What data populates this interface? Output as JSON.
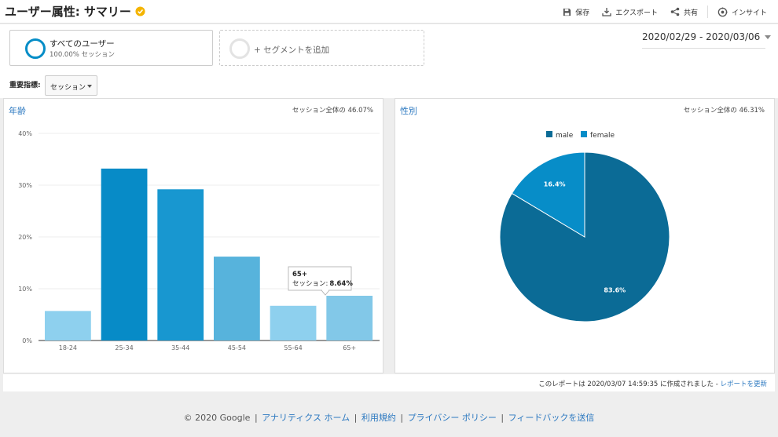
{
  "header": {
    "title": "ユーザー属性: サマリー",
    "toolbar": [
      {
        "icon": "save-icon",
        "label": "保存"
      },
      {
        "icon": "export-icon",
        "label": "エクスポート"
      },
      {
        "icon": "share-icon",
        "label": "共有"
      },
      {
        "icon": "insights-icon",
        "label": "インサイト"
      }
    ]
  },
  "segments": {
    "active": {
      "name": "すべてのユーザー",
      "sub": "100.00% セッション"
    },
    "add_label": "+ セグメントを追加"
  },
  "date_range": "2020/02/29 - 2020/03/06",
  "kpi": {
    "label": "重要指標:",
    "value": "セッション"
  },
  "age_panel": {
    "title": "年齢",
    "meta": "セッション全体の 46.07%"
  },
  "gender_panel": {
    "title": "性別",
    "meta": "セッション全体の 46.31%"
  },
  "tooltip": {
    "category": "65+",
    "label": "セッション:",
    "value": "8.64%"
  },
  "report": {
    "text": "このレポートは 2020/03/07 14:59:35 に作成されました - ",
    "link": "レポートを更新"
  },
  "footer": {
    "copyright": "© 2020 Google",
    "links": [
      "アナリティクス ホーム",
      "利用規約",
      "プライバシー ポリシー",
      "フィードバックを送信"
    ]
  },
  "colors": {
    "accent": "#058dc7",
    "male": "#0b6b96",
    "female": "#078dc8"
  },
  "chart_data": [
    {
      "type": "bar",
      "title": "年齢",
      "categories": [
        "18-24",
        "25-34",
        "35-44",
        "45-54",
        "55-64",
        "65+"
      ],
      "values": [
        5.7,
        33.2,
        29.2,
        16.2,
        6.7,
        8.64
      ],
      "colors": [
        "#8ed0ee",
        "#078bc7",
        "#1897d0",
        "#57b3dc",
        "#8ed0ee",
        "#82c8e8"
      ],
      "ylim": [
        0,
        40
      ],
      "yticks": [
        0,
        10,
        20,
        30,
        40
      ],
      "ytick_labels": [
        "0%",
        "10%",
        "20%",
        "30%",
        "40%"
      ],
      "grid": true
    },
    {
      "type": "pie",
      "title": "性別",
      "labels": [
        "male",
        "female"
      ],
      "values": [
        83.6,
        16.4
      ],
      "value_labels": [
        "83.6%",
        "16.4%"
      ],
      "colors": [
        "#0b6b96",
        "#078dc8"
      ],
      "legend": "top"
    }
  ]
}
